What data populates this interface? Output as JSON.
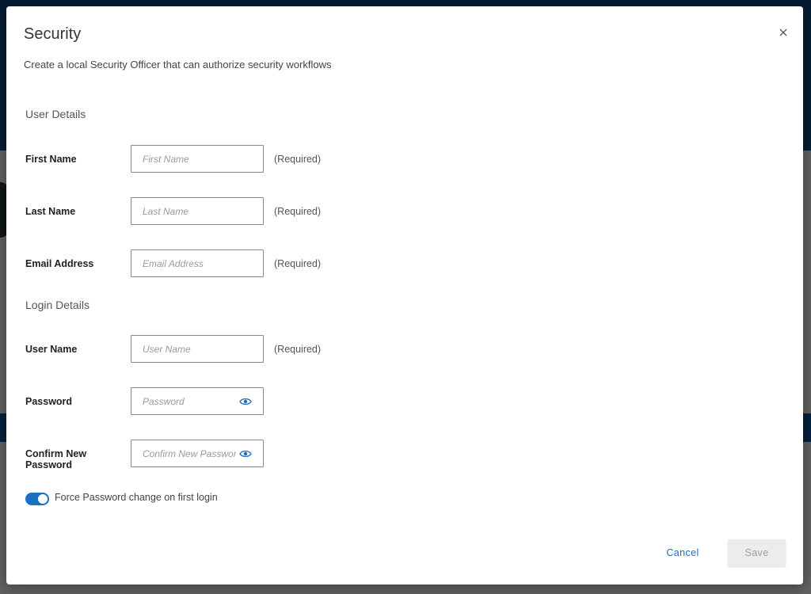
{
  "dialog": {
    "title": "Security",
    "description": "Create a local Security Officer that can authorize security workflows"
  },
  "user_details": {
    "section_title": "User Details",
    "first_name": {
      "label": "First Name",
      "placeholder": "First Name",
      "value": "",
      "hint": "(Required)"
    },
    "last_name": {
      "label": "Last Name",
      "placeholder": "Last Name",
      "value": "",
      "hint": "(Required)"
    },
    "email": {
      "label": "Email Address",
      "placeholder": "Email Address",
      "value": "",
      "hint": "(Required)"
    }
  },
  "login_details": {
    "section_title": "Login Details",
    "user_name": {
      "label": "User Name",
      "placeholder": "User Name",
      "value": "",
      "hint": "(Required)"
    },
    "password": {
      "label": "Password",
      "placeholder": "Password",
      "value": ""
    },
    "confirm_password": {
      "label": "Confirm New Password",
      "placeholder": "Confirm New Password",
      "value": ""
    }
  },
  "force_change": {
    "label": "Force Password change on first login",
    "enabled": true
  },
  "actions": {
    "cancel_label": "Cancel",
    "save_label": "Save",
    "save_enabled": false
  },
  "colors": {
    "accent": "#1b6fc2",
    "background_topbar": "#0d4a86"
  },
  "icons": {
    "close": "close-icon",
    "password_visibility": "eye-icon"
  }
}
